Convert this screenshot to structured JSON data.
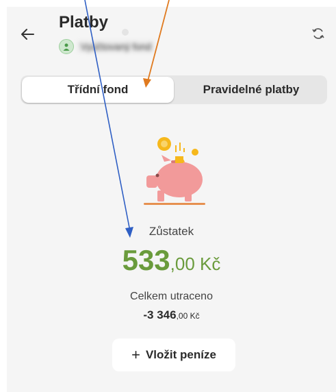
{
  "header": {
    "title": "Platby",
    "subtitle": "Vyúčtovaný fond"
  },
  "tabs": [
    {
      "label": "Třídní fond",
      "active": true
    },
    {
      "label": "Pravidelné platby",
      "active": false
    }
  ],
  "balance": {
    "label": "Zůstatek",
    "integer": "533",
    "decimal": ",00 Kč"
  },
  "spent": {
    "label": "Celkem utraceno",
    "integer": "-3 346",
    "decimal": ",00 Kč"
  },
  "deposit_button": {
    "icon": "+",
    "label": "Vložit peníze"
  },
  "colors": {
    "accent_green": "#6a9b3c",
    "arrow_blue": "#2f5fc4",
    "arrow_orange": "#e07a1f",
    "piggy_pink": "#f29a9a",
    "coin_gold": "#f6b81c"
  },
  "icons": {
    "back": "arrow-left-icon",
    "refresh": "refresh-icon",
    "avatar": "avatar",
    "illustration": "piggy-bank-icon",
    "annotation_arrows": [
      "blue-arrow-icon",
      "orange-arrow-icon"
    ]
  }
}
